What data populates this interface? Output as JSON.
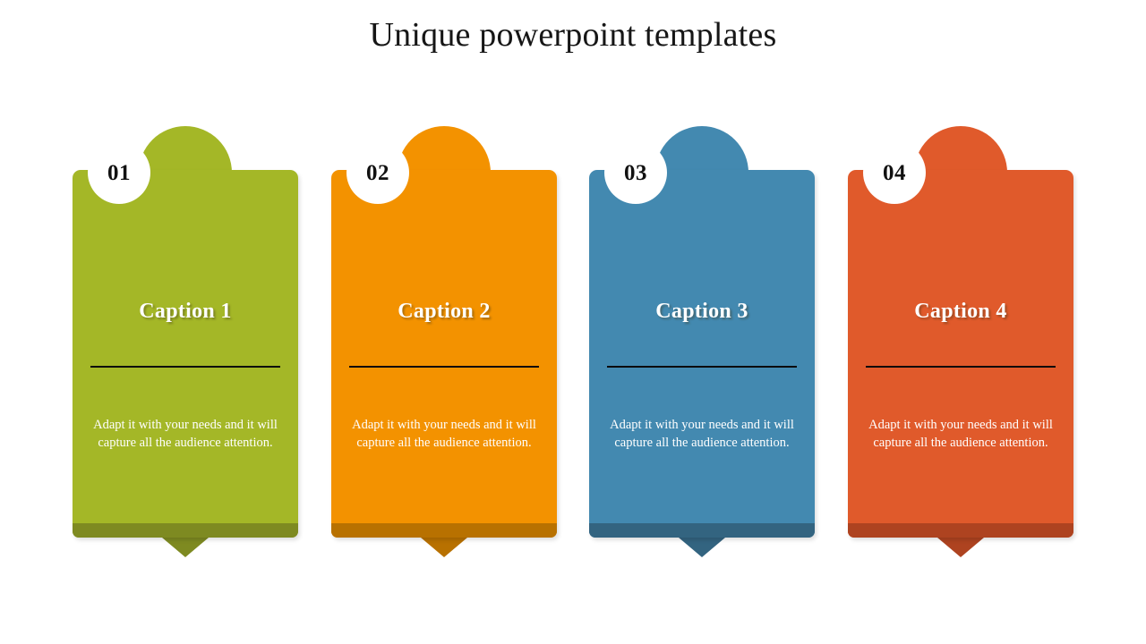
{
  "slide": {
    "title": "Unique powerpoint templates",
    "background": "#FFFFFF",
    "title_color": "#161616"
  },
  "cards": [
    {
      "number": "01",
      "caption": "Caption 1",
      "body": "Adapt it with your needs and it will capture all the audience attention.",
      "color": "#A4B727",
      "dark_color": "#7E8A21",
      "rule_color": "#0B0B0B",
      "text_color": "#FFFFFF"
    },
    {
      "number": "02",
      "caption": "Caption 2",
      "body": "Adapt it with your needs and it will capture all the audience attention.",
      "color": "#F39200",
      "dark_color": "#B87100",
      "rule_color": "#0B0B0B",
      "text_color": "#FFFFFF"
    },
    {
      "number": "03",
      "caption": "Caption 3",
      "body": "Adapt it with your needs and it will capture all the audience attention.",
      "color": "#4389B0",
      "dark_color": "#336480",
      "rule_color": "#0B0B0B",
      "text_color": "#FFFFFF"
    },
    {
      "number": "04",
      "caption": "Caption 4",
      "body": "Adapt it with your needs and it will capture all the audience attention.",
      "color": "#E05A2B",
      "dark_color": "#AE4320",
      "rule_color": "#0B0B0B",
      "text_color": "#FFFFFF"
    }
  ]
}
